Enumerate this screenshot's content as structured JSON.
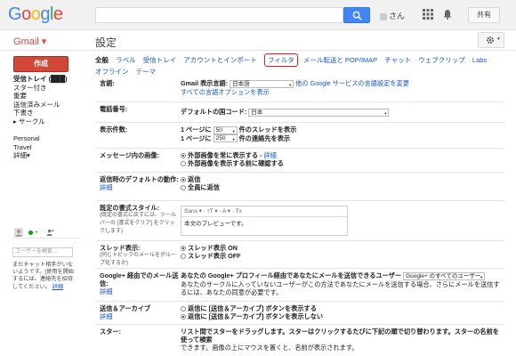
{
  "header": {
    "logo": "Google",
    "user_suffix": "さん",
    "share_label": "共有"
  },
  "subheader": {
    "app_label": "Gmail ▾",
    "page_title": "設定"
  },
  "sidebar": {
    "compose_label": "作成",
    "items": [
      {
        "label": "受信トレイ (███)",
        "bold": true
      },
      {
        "label": "スター付き"
      },
      {
        "label": "重要"
      },
      {
        "label": "送信済みメール"
      },
      {
        "label": "下書き"
      },
      {
        "label": "▸ サークル"
      },
      {
        "label": ""
      },
      {
        "label": "Personal"
      },
      {
        "label": "Travel"
      },
      {
        "label": "詳細▾"
      }
    ],
    "chat_search_placeholder": "ユーザーを検索...",
    "chat_help": "まだチャット相手がいないようです。[使用を開始するには、連絡先を招待してください。",
    "chat_help_link": "詳細"
  },
  "tabs": [
    {
      "label": "全般",
      "active": true
    },
    {
      "label": "ラベル"
    },
    {
      "label": "受信トレイ"
    },
    {
      "label": "アカウントとインポート"
    },
    {
      "label": "フィルタ",
      "highlight": true
    },
    {
      "label": "メール転送と POP/IMAP"
    },
    {
      "label": "チャット"
    },
    {
      "label": "ウェブクリップ"
    },
    {
      "label": "Labs"
    },
    {
      "label": "オフライン"
    },
    {
      "label": "テーマ"
    }
  ],
  "settings": {
    "language": {
      "label": "言語:",
      "display_label": "Gmail 表示言語:",
      "value": "日本語",
      "other_link": "他の Google サービスの言語設定を変更",
      "all_options_link": "すべての言語オプションを表示"
    },
    "phone": {
      "label": "電話番号:",
      "country_label": "デフォルトの国コード:",
      "value": "日本"
    },
    "page_size": {
      "label": "表示件数:",
      "line1_prefix": "1 ページに",
      "line1_value": "50",
      "line1_suffix": "件のスレッドを表示",
      "line2_prefix": "1 ページに",
      "line2_value": "250",
      "line2_suffix": "件の連絡先を表示"
    },
    "images": {
      "label": "メッセージ内の画像:",
      "opt1": "外部画像を常に表示する - ",
      "opt1_link": "詳細",
      "opt2": "外部画像を表示する前に確認する"
    },
    "reply": {
      "label": "返信時のデフォルトの動作:",
      "link": "詳細",
      "opt1": "返信",
      "opt2": "全員に返信"
    },
    "text_style": {
      "label": "既定の書式スタイル:",
      "sub": "(既定の書式に戻すには、ツールバーの [書式をクリア] をクリックします)",
      "toolbar": "Sans ▾  ·  тT ▾  ·  A ▾  ·  Tx",
      "preview": "本文のプレビューです。"
    },
    "threads": {
      "label": "スレッド表示:",
      "sub": "(同じトピックのメールをグループ化するか)",
      "opt1": "スレッド表示 ON",
      "opt2": "スレッド表示 OFF"
    },
    "gplus": {
      "label": "Google+ 経由でのメール送信:",
      "link": "詳細",
      "line1": "あなたの Google+ プロフィール経由であなたにメールを送信できるユーザー",
      "select": "Google+ のすべてのユーザー",
      "line2": "あなたのサークルに入っていないユーザーがこの方法であなたにメールを送信する場合、さらにメールを送信するには、あなたの同意が必要です。"
    },
    "send_archive": {
      "label": "送信＆アーカイブ",
      "link": "詳細",
      "opt1": "返信に [送信＆アーカイブ] ボタンを表示する",
      "opt2": "返信に [送信＆アーカイブ] ボタンを表示しない"
    },
    "stars": {
      "label": "スター:",
      "line1": "リスト間でスターをドラッグします。スターはクリックするたびに下記の順で切り替わります。スターの名前を使って検索",
      "line2": "できます。画像の上にマウスを置くと、名前が表示されます。"
    }
  }
}
